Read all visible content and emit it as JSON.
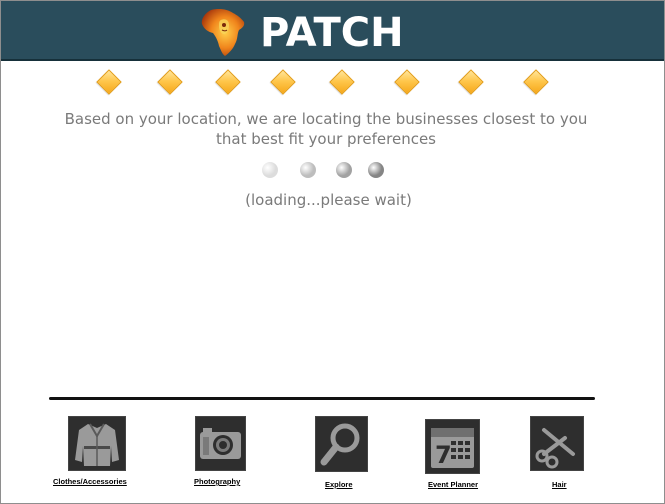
{
  "header": {
    "brand": "PATCH"
  },
  "loader": {
    "message": "Based on your location, we are locating the businesses closest to you that best fit your preferences",
    "status": "(loading...please wait)",
    "dot_colors": [
      "#dcdcdc",
      "#bdbdbd",
      "#a2a2a2",
      "#858585"
    ]
  },
  "categories": [
    {
      "label": "Clothes/Accessories",
      "icon": "coat-icon"
    },
    {
      "label": "Photography",
      "icon": "camera-icon"
    },
    {
      "label": "Explore",
      "icon": "magnifier-icon"
    },
    {
      "label": "Event Planner",
      "icon": "calendar-icon"
    },
    {
      "label": "Hair",
      "icon": "scissors-icon"
    }
  ],
  "colors": {
    "header_bg": "#2a4d5c",
    "accent_diamond": "#ffc74d",
    "tile_bg": "#2e2e2e"
  }
}
